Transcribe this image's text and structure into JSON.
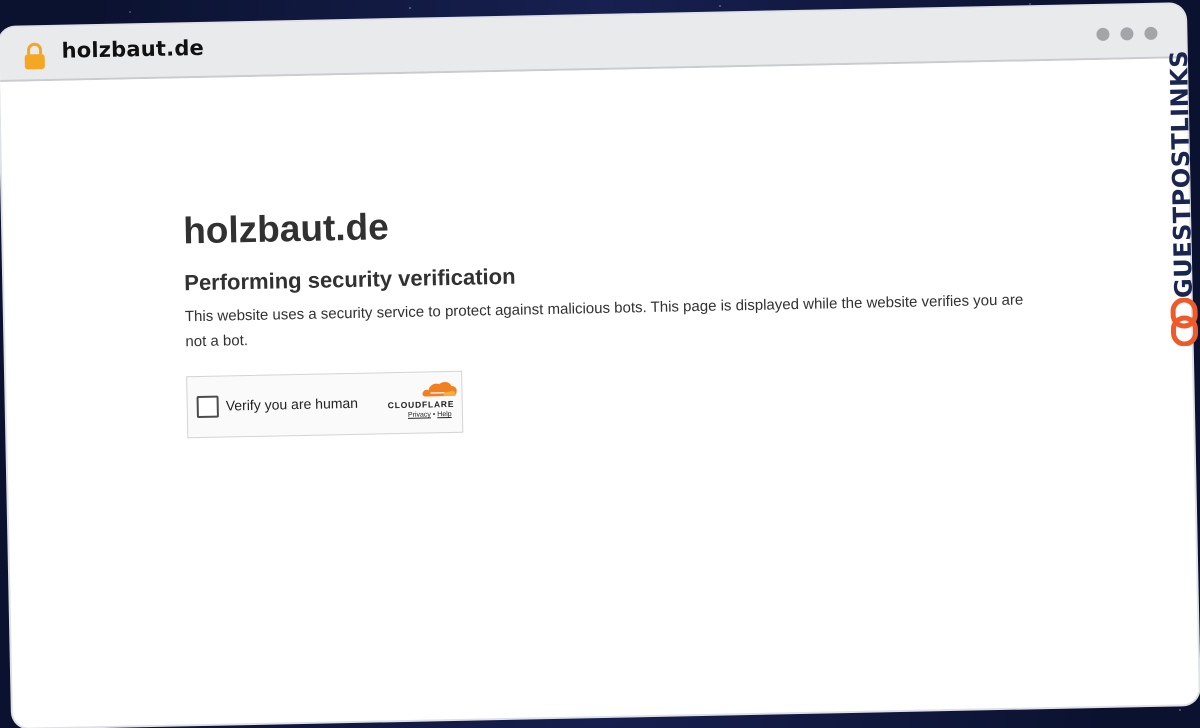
{
  "browser": {
    "tab_domain": "holzbaut.de",
    "lock_icon": "lock-icon",
    "window_controls": [
      "dot",
      "dot",
      "dot"
    ]
  },
  "page": {
    "site_title": "holzbaut.de",
    "heading": "Performing security verification",
    "description": "This website uses a security service to protect against malicious bots. This page is displayed while the website verifies you are not a bot."
  },
  "challenge_widget": {
    "checkbox_label": "Verify you are human",
    "checked": false,
    "provider_logo_text": "CLOUDFLARE",
    "privacy_link": "Privacy",
    "separator": "•",
    "help_link": "Help",
    "icon": "cloudflare-cloud-icon"
  },
  "watermark": {
    "text": "GUESTPOSTLINKS",
    "icon": "chain-link-icon"
  },
  "colors": {
    "lock": "#f5a623",
    "cloudflare_orange": "#f38020",
    "watermark_orange": "#f05a28",
    "watermark_navy": "#1a2550"
  }
}
